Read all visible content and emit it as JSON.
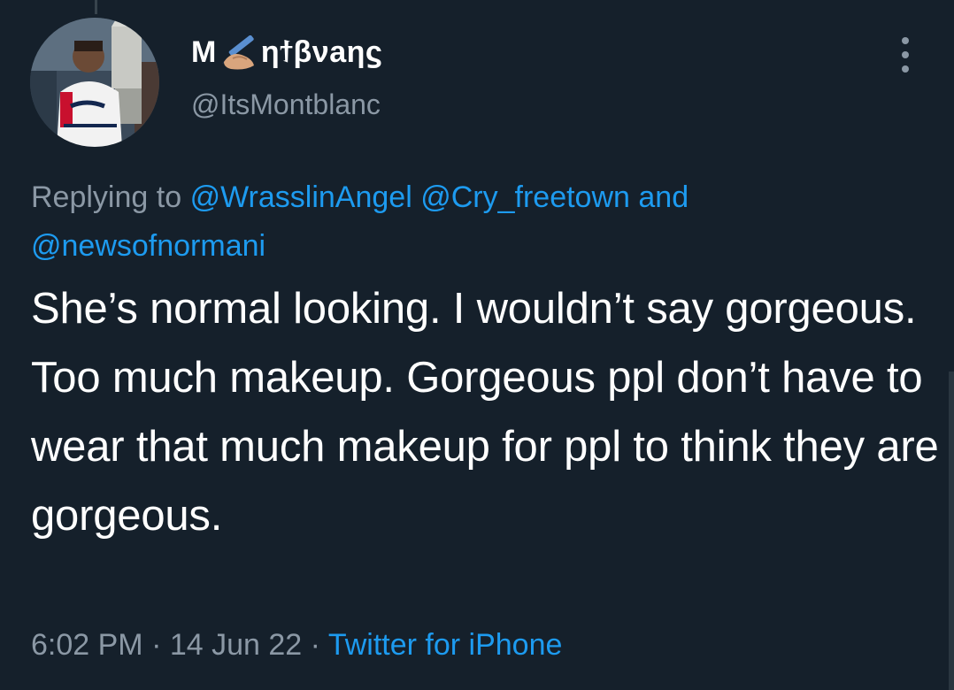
{
  "author": {
    "name_prefix": "M",
    "name_emoji": "writing-hand-emoji",
    "name_suffix": "ηϯβνаηϛ",
    "handle": "@ItsMontblanc",
    "avatar_icon": "profile-avatar"
  },
  "reply": {
    "prefix": "Replying to",
    "mentions": [
      "@WrasslinAngel",
      "@Cry_freetown",
      "@newsofnormani"
    ],
    "connector": "and"
  },
  "tweet": {
    "text": "She’s normal looking. I wouldn’t say gorgeous. Too much makeup. Gorgeous ppl don’t have to wear that much makeup for ppl to think they are gorgeous."
  },
  "meta": {
    "time": "6:02 PM",
    "date": "14 Jun 22",
    "separator": "·",
    "source": "Twitter for iPhone"
  },
  "colors": {
    "background": "#15202b",
    "text": "#ffffff",
    "secondary": "#8b98a5",
    "link": "#1d9bf0"
  }
}
